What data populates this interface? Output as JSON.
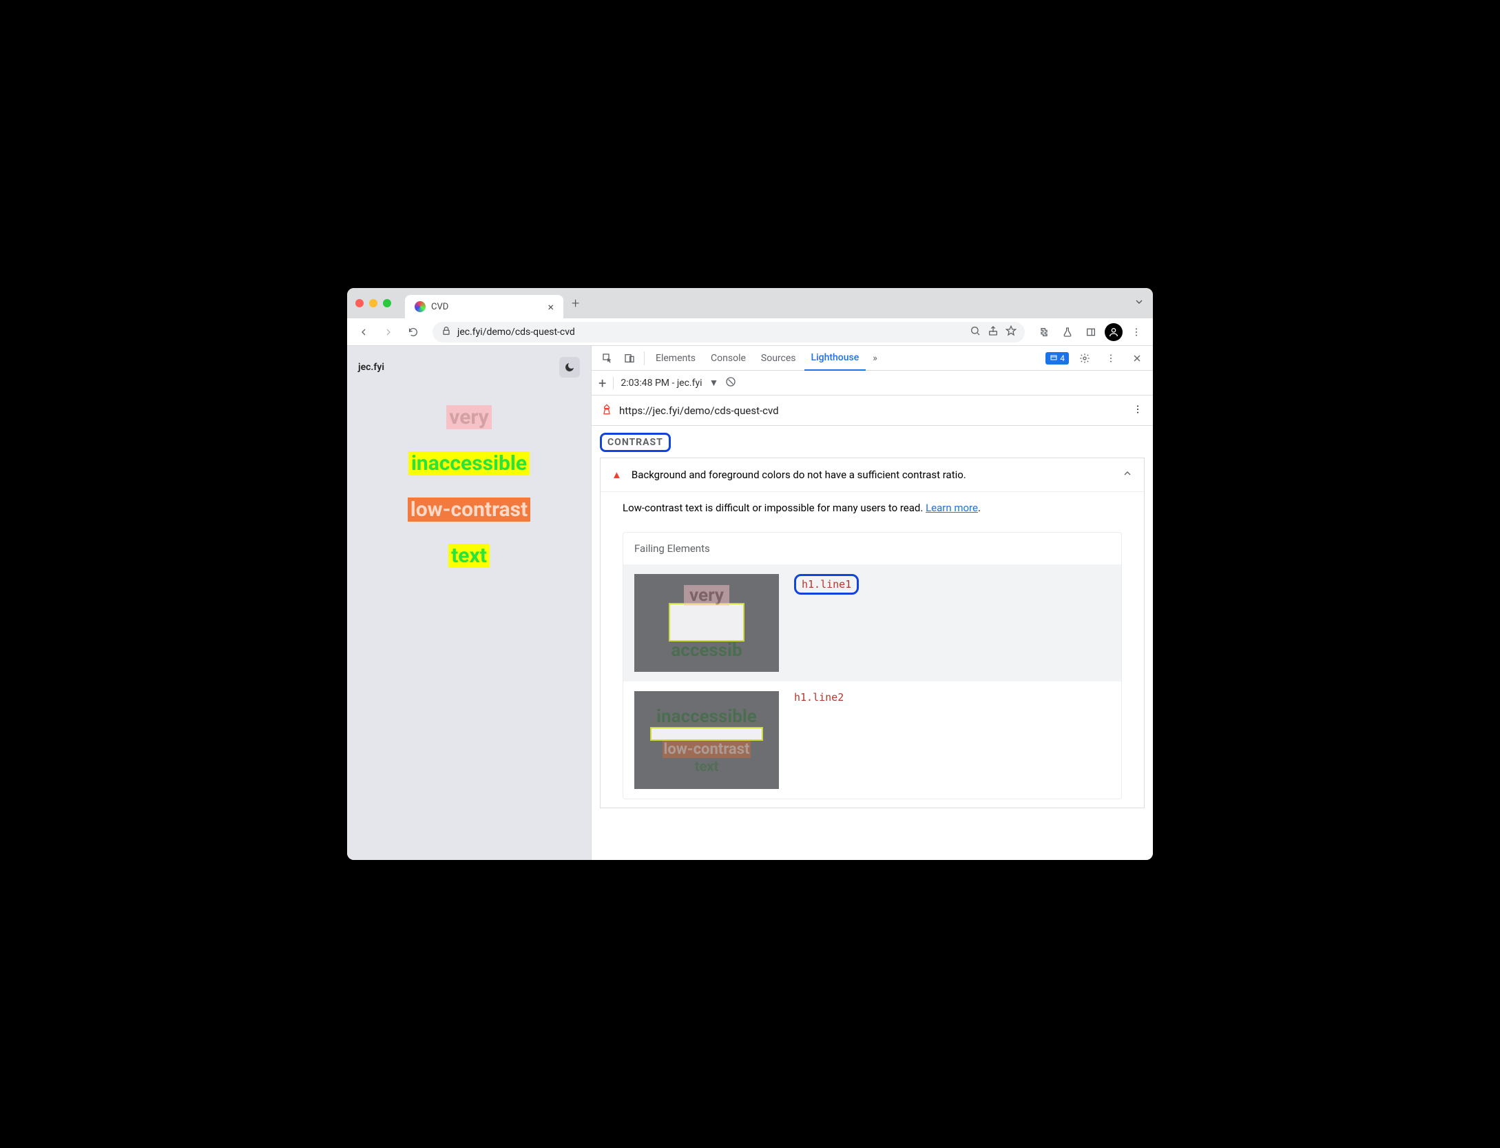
{
  "browser": {
    "tab_title": "CVD",
    "url_display": "jec.fyi/demo/cds-quest-cvd"
  },
  "page": {
    "site_title": "jec.fyi",
    "lines": [
      "very",
      "inaccessible",
      "low-contrast",
      "text"
    ]
  },
  "devtools": {
    "tabs": [
      "Elements",
      "Console",
      "Sources",
      "Lighthouse"
    ],
    "active_tab": "Lighthouse",
    "badge_count": "4",
    "subbar_time": "2:03:48 PM - jec.fyi",
    "report_url": "https://jec.fyi/demo/cds-quest-cvd",
    "section": "CONTRAST",
    "audit": {
      "title": "Background and foreground colors do not have a sufficient contrast ratio.",
      "description_pre": "Low-contrast text is difficult or impossible for many users to read. ",
      "learn_more": "Learn more",
      "failing_title": "Failing Elements",
      "failing": [
        {
          "selector": "h1.line1"
        },
        {
          "selector": "h1.line2"
        }
      ]
    }
  }
}
